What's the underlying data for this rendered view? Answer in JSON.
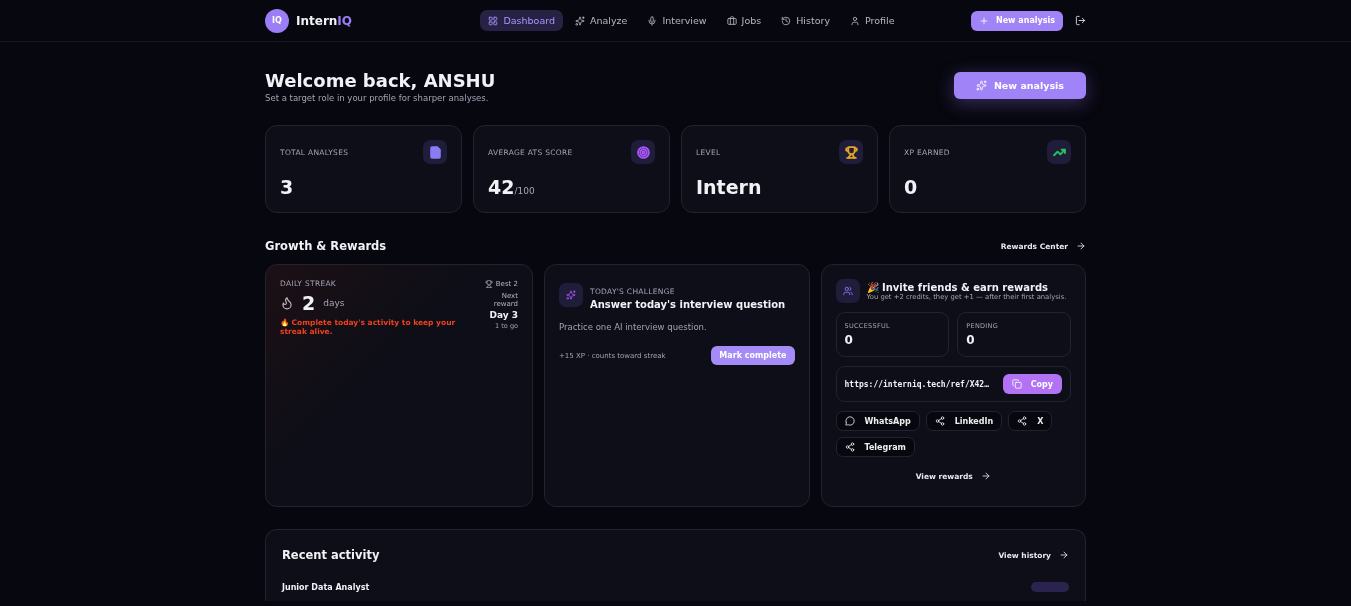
{
  "brand": {
    "mark": "IQ",
    "name_start": "Intern",
    "name_end": "IQ"
  },
  "nav": [
    {
      "label": "Dashboard",
      "selected": true
    },
    {
      "label": "Analyze",
      "selected": false
    },
    {
      "label": "Interview",
      "selected": false
    },
    {
      "label": "Jobs",
      "selected": false
    },
    {
      "label": "History",
      "selected": false
    },
    {
      "label": "Profile",
      "selected": false
    }
  ],
  "nav_button": "New analysis",
  "welcome": {
    "title": "Welcome back, ANSHU",
    "subtitle": "Set a target role in your profile for sharper analyses.",
    "button": "New analysis"
  },
  "stats": [
    {
      "label": "TOTAL ANALYSES",
      "value": "3",
      "color": "#8b7cf6"
    },
    {
      "label": "AVERAGE ATS SCORE",
      "value": "42",
      "suffix": "/100",
      "color": "#a855f7"
    },
    {
      "label": "LEVEL",
      "value": "Intern",
      "color": "#e0a526"
    },
    {
      "label": "XP EARNED",
      "value": "0",
      "color": "#22c55e"
    }
  ],
  "growth": {
    "title": "Growth & Rewards",
    "link": "Rewards Center"
  },
  "streak": {
    "label": "DAILY STREAK",
    "best": "Best 2",
    "count": "2",
    "unit": "days",
    "warning": "🔥 Complete today's activity to keep your streak alive.",
    "next_label": "Next reward",
    "next_value": "Day 3",
    "next_hint": "1 to go"
  },
  "challenge": {
    "eyebrow": "TODAY'S CHALLENGE",
    "title": "Answer today's interview question",
    "text": "Practice one AI interview question.",
    "meta": "+15 XP · counts toward streak",
    "button": "Mark complete"
  },
  "invite": {
    "title": "🎉 Invite friends & earn rewards",
    "subtitle": "You get +2 credits, they get +1 — after their first analysis.",
    "stats": [
      {
        "label": "SUCCESSFUL",
        "value": "0"
      },
      {
        "label": "PENDING",
        "value": "0"
      }
    ],
    "link": "https://interniq.tech/ref/X42…",
    "copy": "Copy",
    "shares": [
      {
        "label": "WhatsApp",
        "kind": "chat"
      },
      {
        "label": "LinkedIn",
        "kind": "share"
      },
      {
        "label": "X",
        "kind": "share"
      },
      {
        "label": "Telegram",
        "kind": "share"
      }
    ],
    "more": "View rewards"
  },
  "recent": {
    "title": "Recent activity",
    "link": "View history",
    "rows": [
      {
        "title": "Junior Data Analyst"
      }
    ]
  }
}
